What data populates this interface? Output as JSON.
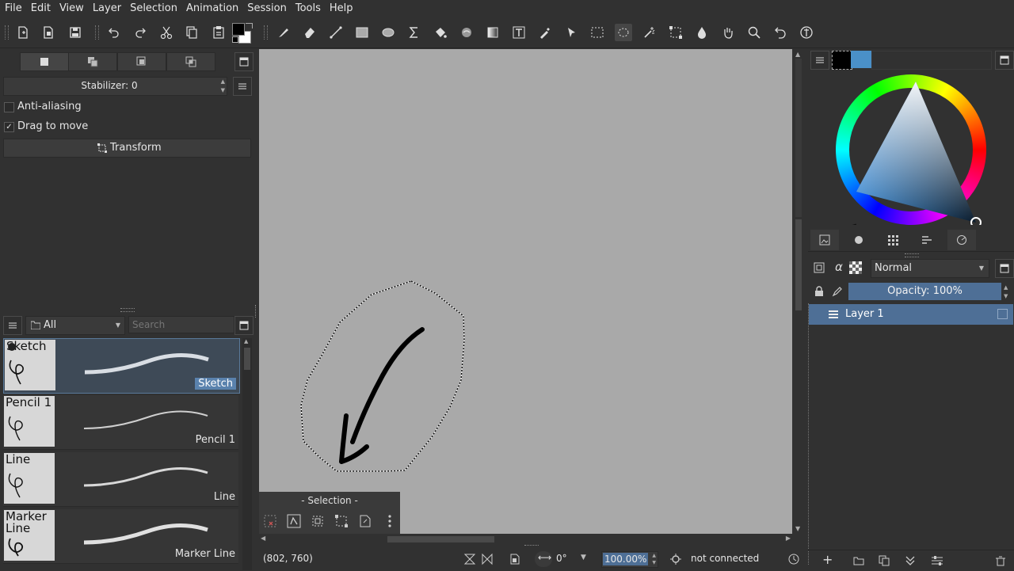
{
  "menu": [
    "File",
    "Edit",
    "View",
    "Layer",
    "Selection",
    "Animation",
    "Session",
    "Tools",
    "Help"
  ],
  "toolbar": {
    "icons": [
      "new-document-icon",
      "open-template-icon",
      "save-icon",
      "undo-icon",
      "redo-icon",
      "cut-icon",
      "copy-icon",
      "paste-icon",
      "color-swatch-icon",
      "freehand-brush-icon",
      "eraser-icon",
      "line-icon",
      "rectangle-icon",
      "ellipse-icon",
      "sigma-icon",
      "fill-icon",
      "smudge-icon",
      "gradient-icon",
      "text-icon",
      "color-picker-icon",
      "select-shapes-icon",
      "rect-select-icon",
      "lasso-select-icon",
      "magic-wand-icon",
      "transform-icon",
      "smart-patch-icon",
      "pan-icon",
      "zoom-icon",
      "reset-rotation-icon",
      "measure-icon"
    ],
    "colors": {
      "foreground": "#000000",
      "background": "#ffffff"
    }
  },
  "tool_options": {
    "stabilizer": "Stabilizer: 0",
    "anti_aliasing": "Anti-aliasing",
    "anti_aliasing_checked": false,
    "drag_to_move": "Drag to move",
    "drag_to_move_checked": true,
    "transform_button": "Transform"
  },
  "presets": {
    "filter": "All",
    "search_placeholder": "Search",
    "items": [
      {
        "name": "Sketch",
        "thumb": "Sketch",
        "selected": true
      },
      {
        "name": "Pencil 1",
        "thumb": "Pencil 1",
        "selected": false
      },
      {
        "name": "Line",
        "thumb": "Line",
        "selected": false
      },
      {
        "name": "Marker Line",
        "thumb": "Marker Line",
        "selected": false
      }
    ]
  },
  "selection_panel": {
    "title": "- Selection -"
  },
  "status": {
    "coords": "(802, 760)",
    "rotation": "0°",
    "zoom": "100.00%",
    "connection": "not connected"
  },
  "right": {
    "blend_mode": "Normal",
    "opacity": "Opacity: 100%",
    "layer_name": "Layer 1",
    "colors": {
      "fg": "#000000",
      "recent": "#4a90c8"
    }
  }
}
